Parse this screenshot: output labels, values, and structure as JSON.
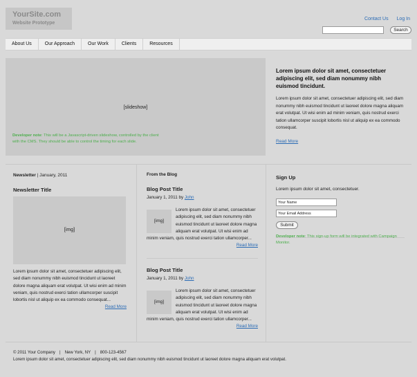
{
  "header": {
    "logo_name": "YourSite.com",
    "logo_sub": "Website Prototype",
    "contact_link": "Contact Us",
    "login_link": "Log In",
    "search_placeholder": "",
    "search_button": "Search"
  },
  "nav": {
    "items": [
      "About Us",
      "Our Approach",
      "Our Work",
      "Clients",
      "Resources"
    ]
  },
  "hero": {
    "slideshow_label": "[slideshow]",
    "dev_note_label": "Developer note",
    "dev_note_text": ": This will be a Javascript-driven slideshow, controlled by the client with the CMS. They should be able to control the timing for each slide.",
    "title": "Lorem ipsum dolor sit amet, consectetuer adipiscing elit, sed diam nonummy nibh euismod tincidunt.",
    "body": "Lorem ipsum dolor sit amet, consectetuer adipiscing elit, sed diam nonummy nibh euismod tincidunt ut laoreet dolore magna aliquam erat volutpat. Ut wisi enim ad minim veniam, quis nostrud exerci tation ullamcorper suscipit lobortis nisl ut aliquip ex ea commodo consequat.",
    "read_more": "Read More"
  },
  "newsletter": {
    "heading_bold": "Newsletter",
    "heading_rest": " | January, 2011",
    "title": "Newsletter Title",
    "img_label": "[img]",
    "body": "Lorem ipsum dolor sit amet, consectetuer adipiscing elit, sed diam nonummy nibh euismod tincidunt ut laoreet dolore magna aliquam erat volutpat. Ut wisi enim ad minim veniam, quis nostrud exerci tation ullamcorper suscipit lobortis nisl ut aliquip ex ea commodo consequat...",
    "read_more": "Read More"
  },
  "blog": {
    "heading": "From the Blog",
    "posts": [
      {
        "title": "Blog Post Title",
        "date": "January 1, 2011 by ",
        "author": "John",
        "img_label": "[img]",
        "body": "Lorem ipsum dolor sit amet, consectetuer adipiscing elit, sed diam nonummy nibh euismod tincidunt ut laoreet dolore magna aliquam erat volutpat. Ut wisi enim ad minim veniam, quis nostrud exerci tation ullamcorper...",
        "read_more": "Read More"
      },
      {
        "title": "Blog Post Title",
        "date": "January 1, 2011 by ",
        "author": "John",
        "img_label": "[img]",
        "body": "Lorem ipsum dolor sit amet, consectetuer adipiscing elit, sed diam nonummy nibh euismod tincidunt ut laoreet dolore magna aliquam erat volutpat. Ut wisi enim ad minim veniam, quis nostrud exerci tation ullamcorper...",
        "read_more": "Read More"
      }
    ]
  },
  "signup": {
    "title": "Sign Up",
    "text": "Lorem ipsum dolor sit amet, consectetuer.",
    "name_value": "Your Name",
    "email_value": "Your Email Address",
    "submit": "Submit",
    "dev_note_label": "Developer note",
    "dev_note_text": ": This sign-up form will be integrated with Campaign Monitor."
  },
  "footer": {
    "copyright": "© 2011 Your Company",
    "location": "New York, NY",
    "phone": "800-123-4567",
    "separator": "|",
    "text": "Lorem ipsum dolor sit amet, consectetuer adipiscing elit, sed diam nonummy nibh euismod tincidunt ut laoreet dolore magna aliquam erat volutpat."
  },
  "colors": {
    "background": "#d9d9d9",
    "link": "#2a6bb5",
    "developer_note": "#4cae4c",
    "placeholder_box": "#c9c9c9"
  }
}
